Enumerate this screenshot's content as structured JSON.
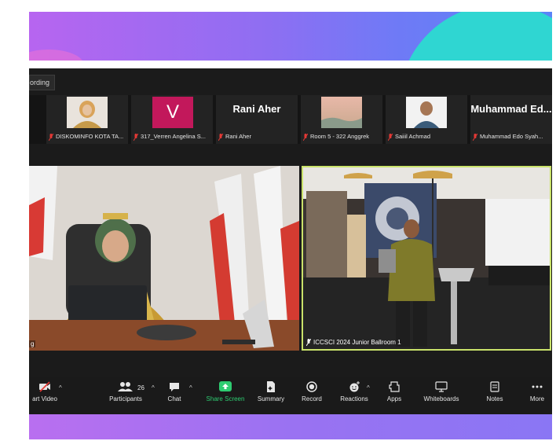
{
  "recording_tab": "ording",
  "participants_strip": [
    {
      "label": "DISKOMINFO KOTA TA...",
      "type": "photo"
    },
    {
      "label": "317_Verren Angelina S...",
      "type": "initial",
      "initial": "V",
      "color": "#c2185b"
    },
    {
      "label": "Rani Aher",
      "type": "name",
      "name": "Rani Aher"
    },
    {
      "label": "Room 5 - 322 Anggrek",
      "type": "photo"
    },
    {
      "label": "Saiiil Achmad",
      "type": "photo"
    },
    {
      "label": "Muhammad Edo Syah...",
      "type": "name",
      "name": "Muhammad  Ed..."
    }
  ],
  "main_left_label": "g",
  "main_right_label": "ICCSCI 2024 Junior Ballroom 1",
  "toolbar": {
    "start_video": "art Video",
    "participants": "Participants",
    "participants_count": "26",
    "chat": "Chat",
    "share_screen": "Share Screen",
    "summary": "Summary",
    "record": "Record",
    "reactions": "Reactions",
    "apps": "Apps",
    "whiteboards": "Whiteboards",
    "notes": "Notes",
    "more": "More"
  },
  "colors": {
    "share_green": "#2ecc71",
    "active_border": "#c9e26a",
    "mic_muted": "#e53935"
  }
}
